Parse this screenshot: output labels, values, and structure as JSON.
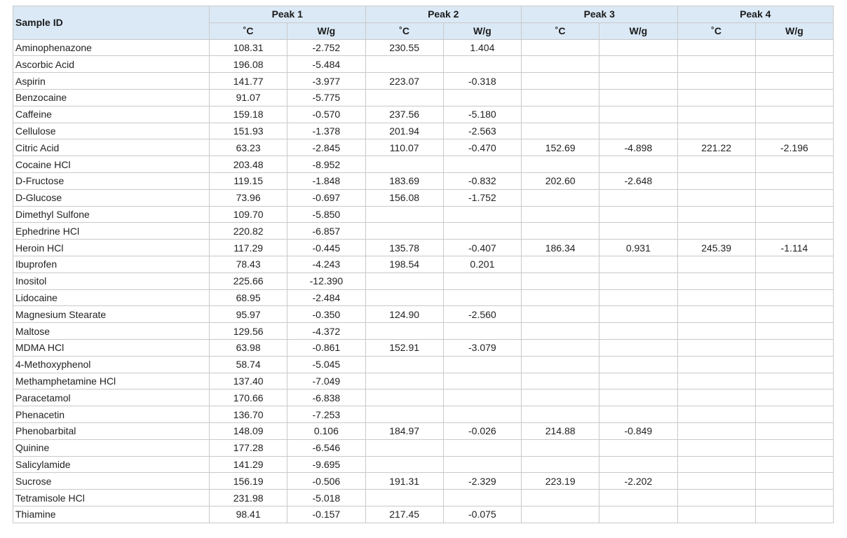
{
  "table": {
    "sample_header": "Sample ID",
    "peaks": [
      "Peak 1",
      "Peak 2",
      "Peak 3",
      "Peak 4"
    ],
    "units": [
      "˚C",
      "W/g",
      "˚C",
      "W/g",
      "˚C",
      "W/g",
      "˚C",
      "W/g"
    ],
    "rows": [
      {
        "name": "Aminophenazone",
        "values": [
          "108.31",
          "-2.752",
          "230.55",
          "1.404",
          "",
          "",
          "",
          ""
        ]
      },
      {
        "name": "Ascorbic Acid",
        "values": [
          "196.08",
          "-5.484",
          "",
          "",
          "",
          "",
          "",
          ""
        ]
      },
      {
        "name": "Aspirin",
        "values": [
          "141.77",
          "-3.977",
          "223.07",
          "-0.318",
          "",
          "",
          "",
          ""
        ]
      },
      {
        "name": "Benzocaine",
        "values": [
          "91.07",
          "-5.775",
          "",
          "",
          "",
          "",
          "",
          ""
        ]
      },
      {
        "name": "Caffeine",
        "values": [
          "159.18",
          "-0.570",
          "237.56",
          "-5.180",
          "",
          "",
          "",
          ""
        ]
      },
      {
        "name": "Cellulose",
        "values": [
          "151.93",
          "-1.378",
          "201.94",
          "-2.563",
          "",
          "",
          "",
          ""
        ]
      },
      {
        "name": "Citric Acid",
        "values": [
          "63.23",
          "-2.845",
          "110.07",
          "-0.470",
          "152.69",
          "-4.898",
          "221.22",
          "-2.196"
        ]
      },
      {
        "name": "Cocaine HCl",
        "values": [
          "203.48",
          "-8.952",
          "",
          "",
          "",
          "",
          "",
          ""
        ]
      },
      {
        "name": "D-Fructose",
        "values": [
          "119.15",
          "-1.848",
          "183.69",
          "-0.832",
          "202.60",
          "-2.648",
          "",
          ""
        ]
      },
      {
        "name": "D-Glucose",
        "values": [
          "73.96",
          "-0.697",
          "156.08",
          "-1.752",
          "",
          "",
          "",
          ""
        ]
      },
      {
        "name": "Dimethyl Sulfone",
        "values": [
          "109.70",
          "-5.850",
          "",
          "",
          "",
          "",
          "",
          ""
        ]
      },
      {
        "name": "Ephedrine HCl",
        "values": [
          "220.82",
          "-6.857",
          "",
          "",
          "",
          "",
          "",
          ""
        ]
      },
      {
        "name": "Heroin HCl",
        "values": [
          "117.29",
          "-0.445",
          "135.78",
          "-0.407",
          "186.34",
          "0.931",
          "245.39",
          "-1.114"
        ]
      },
      {
        "name": "Ibuprofen",
        "values": [
          "78.43",
          "-4.243",
          "198.54",
          "0.201",
          "",
          "",
          "",
          ""
        ]
      },
      {
        "name": "Inositol",
        "values": [
          "225.66",
          "-12.390",
          "",
          "",
          "",
          "",
          "",
          ""
        ]
      },
      {
        "name": "Lidocaine",
        "values": [
          "68.95",
          "-2.484",
          "",
          "",
          "",
          "",
          "",
          ""
        ]
      },
      {
        "name": "Magnesium Stearate",
        "values": [
          "95.97",
          "-0.350",
          "124.90",
          "-2.560",
          "",
          "",
          "",
          ""
        ]
      },
      {
        "name": "Maltose",
        "values": [
          "129.56",
          "-4.372",
          "",
          "",
          "",
          "",
          "",
          ""
        ]
      },
      {
        "name": "MDMA HCl",
        "values": [
          "63.98",
          "-0.861",
          "152.91",
          "-3.079",
          "",
          "",
          "",
          ""
        ]
      },
      {
        "name": "4-Methoxyphenol",
        "values": [
          "58.74",
          "-5.045",
          "",
          "",
          "",
          "",
          "",
          ""
        ]
      },
      {
        "name": "Methamphetamine HCl",
        "values": [
          "137.40",
          "-7.049",
          "",
          "",
          "",
          "",
          "",
          ""
        ]
      },
      {
        "name": "Paracetamol",
        "values": [
          "170.66",
          "-6.838",
          "",
          "",
          "",
          "",
          "",
          ""
        ]
      },
      {
        "name": "Phenacetin",
        "values": [
          "136.70",
          "-7.253",
          "",
          "",
          "",
          "",
          "",
          ""
        ]
      },
      {
        "name": "Phenobarbital",
        "values": [
          "148.09",
          "0.106",
          "184.97",
          "-0.026",
          "214.88",
          "-0.849",
          "",
          ""
        ]
      },
      {
        "name": "Quinine",
        "values": [
          "177.28",
          "-6.546",
          "",
          "",
          "",
          "",
          "",
          ""
        ]
      },
      {
        "name": "Salicylamide",
        "values": [
          "141.29",
          "-9.695",
          "",
          "",
          "",
          "",
          "",
          ""
        ]
      },
      {
        "name": "Sucrose",
        "values": [
          "156.19",
          "-0.506",
          "191.31",
          "-2.329",
          "223.19",
          "-2.202",
          "",
          ""
        ]
      },
      {
        "name": "Tetramisole HCl",
        "values": [
          "231.98",
          "-5.018",
          "",
          "",
          "",
          "",
          "",
          ""
        ]
      },
      {
        "name": "Thiamine",
        "values": [
          "98.41",
          "-0.157",
          "217.45",
          "-0.075",
          "",
          "",
          "",
          ""
        ]
      }
    ]
  }
}
